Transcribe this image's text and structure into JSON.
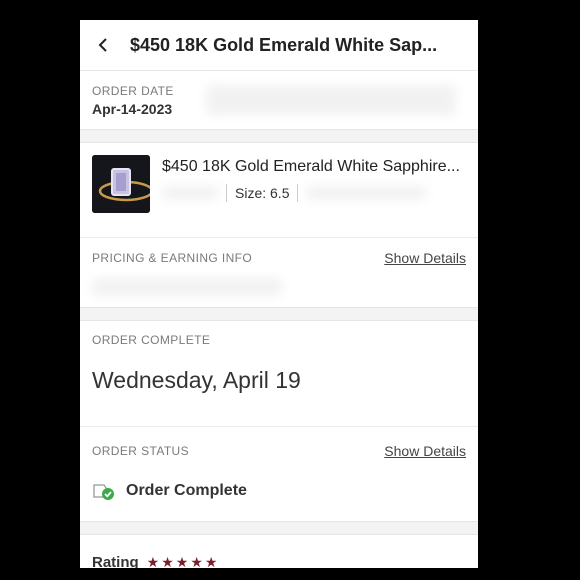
{
  "header": {
    "title": "$450  18K Gold Emerald White Sap..."
  },
  "order_date": {
    "label": "ORDER DATE",
    "value": "Apr-14-2023"
  },
  "product": {
    "title": "$450 18K Gold Emerald White Sapphire...",
    "size": "Size: 6.5"
  },
  "pricing": {
    "label": "PRICING & EARNING INFO",
    "link": "Show Details"
  },
  "order_complete": {
    "label": "ORDER COMPLETE",
    "date": "Wednesday, April 19"
  },
  "order_status": {
    "label": "ORDER STATUS",
    "link": "Show Details",
    "status": "Order Complete"
  },
  "rating": {
    "label": "Rating",
    "stars": 5,
    "star_color": "#7a1f2b"
  }
}
